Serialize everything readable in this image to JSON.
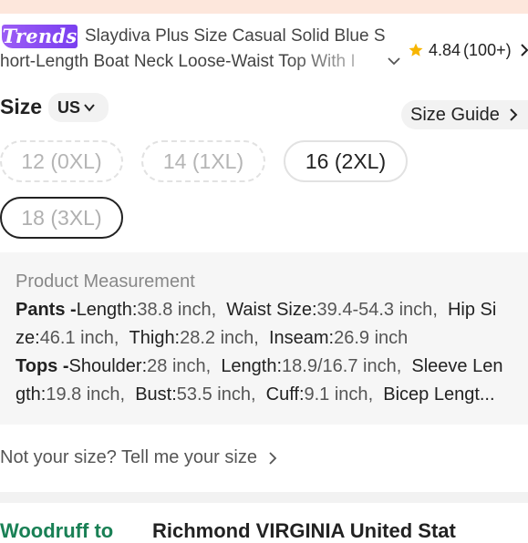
{
  "product": {
    "badge": "Trends",
    "title_line1": "Slaydiva Plus Size Casual Solid Blue S",
    "title_line2": "hort-Length Boat Neck Loose-Waist Top With I",
    "rating_score": "4.84",
    "rating_count": "(100+)"
  },
  "size_selector": {
    "label": "Size",
    "unit": "US",
    "size_guide_label": "Size Guide",
    "options": [
      {
        "label": "12 (0XL)",
        "state": "out-of-stock"
      },
      {
        "label": "14 (1XL)",
        "state": "out-of-stock"
      },
      {
        "label": "16 (2XL)",
        "state": "available"
      },
      {
        "label": "18 (3XL)",
        "state": "selected-out-of-stock"
      }
    ]
  },
  "measurement": {
    "title": "Product Measurement",
    "pants_label": "Pants -",
    "tops_label": "Tops -",
    "pants": [
      {
        "k": "Length:",
        "v": "38.8 inch"
      },
      {
        "k": "Waist Size:",
        "v": "39.4-54.3 inch"
      },
      {
        "k": "Hip Size:",
        "v": "46.1 inch"
      },
      {
        "k": "Thigh:",
        "v": "28.2 inch"
      },
      {
        "k": "Inseam:",
        "v": "26.9 inch"
      }
    ],
    "tops": [
      {
        "k": "Shoulder:",
        "v": "28 inch"
      },
      {
        "k": "Length:",
        "v": "18.9/16.7 inch"
      },
      {
        "k": "Sleeve Length:",
        "v": "19.8 inch"
      },
      {
        "k": "Bust:",
        "v": "53.5 inch"
      },
      {
        "k": "Cuff:",
        "v": "9.1 inch"
      },
      {
        "k": "Bicep Lengt…",
        "v": ""
      }
    ],
    "line1": {
      "k1": "Length:",
      "v1": "38.8 inch",
      "k2": "Waist Size:",
      "v2": "39.4-54.3 inch",
      "k3": "Hip Si"
    },
    "line2": {
      "k0": "ze:",
      "v0": "46.1 inch",
      "k1": "Thigh:",
      "v1": "28.2 inch",
      "k2": "Inseam:",
      "v2": "26.9 inch"
    },
    "line3": {
      "k1": "Shoulder:",
      "v1": "28 inch",
      "k2": "Length:",
      "v2": "18.9/16.7 inch",
      "k3": "Sleeve Len"
    },
    "line4": {
      "k0": "gth:",
      "v0": "19.8 inch",
      "k1": "Bust:",
      "v1": "53.5 inch",
      "k2": "Cuff:",
      "v2": "9.1 inch",
      "k3": "Bicep Lengt..."
    }
  },
  "not_your_size": "Not your size? Tell me your size",
  "shipping_cut": {
    "left": "Woodruff to",
    "right": "Richmond VIRGINIA United Stat"
  },
  "colors": {
    "badge_purple": "#8a4cf3",
    "star_yellow": "#f7b500",
    "shipping_green": "#198055"
  }
}
